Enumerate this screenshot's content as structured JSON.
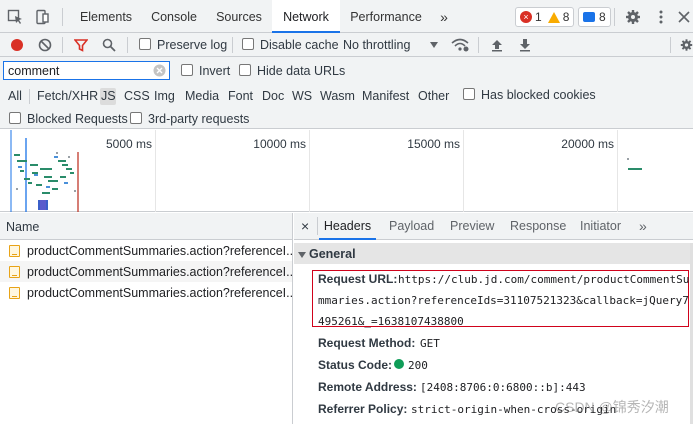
{
  "tabs": {
    "items": [
      "Elements",
      "Console",
      "Sources",
      "Network",
      "Performance"
    ],
    "active": "Network",
    "more": "»"
  },
  "badges": {
    "errors": "1",
    "warnings": "8",
    "messages": "8"
  },
  "toolbar": {
    "preserve_log": "Preserve log",
    "disable_cache": "Disable cache",
    "throttling": "No throttling"
  },
  "filter": {
    "value": "comment",
    "invert": "Invert",
    "hide_data_urls": "Hide data URLs"
  },
  "types": {
    "items": [
      "All",
      "Fetch/XHR",
      "JS",
      "CSS",
      "Img",
      "Media",
      "Font",
      "Doc",
      "WS",
      "Wasm",
      "Manifest",
      "Other"
    ],
    "selected": "JS",
    "has_blocked_cookies": "Has blocked cookies",
    "blocked_requests": "Blocked Requests",
    "third_party": "3rd-party requests"
  },
  "overview": {
    "ticks": [
      "5000 ms",
      "10000 ms",
      "15000 ms",
      "20000 ms"
    ]
  },
  "requests": {
    "column_header": "Name",
    "rows": [
      "productCommentSummaries.action?referenceI...",
      "productCommentSummaries.action?referenceI...",
      "productCommentSummaries.action?referenceI..."
    ]
  },
  "details": {
    "tabs": [
      "Headers",
      "Payload",
      "Preview",
      "Response",
      "Initiator"
    ],
    "active": "Headers",
    "more": "»",
    "close": "×",
    "section": "General",
    "request_url_label": "Request URL:",
    "request_url_lines": [
      "https://club.jd.com/comment/productCommentSu",
      "mmaries.action?referenceIds=31107521323&callback=jQuery7",
      "495261&_=1638107438800"
    ],
    "request_method_label": "Request Method:",
    "request_method": "GET",
    "status_code_label": "Status Code:",
    "status_code": "200",
    "remote_address_label": "Remote Address:",
    "remote_address": "[2408:8706:0:6800::b]:443",
    "referrer_policy_label": "Referrer Policy:",
    "referrer_policy": "strict-origin-when-cross-origin"
  },
  "watermark": "CSDN @锦秀汐潮",
  "colors": {
    "accent": "#1a73e8",
    "record": "#d93025",
    "status_ok": "#0f9d58",
    "highlight_box": "#d0021b"
  }
}
